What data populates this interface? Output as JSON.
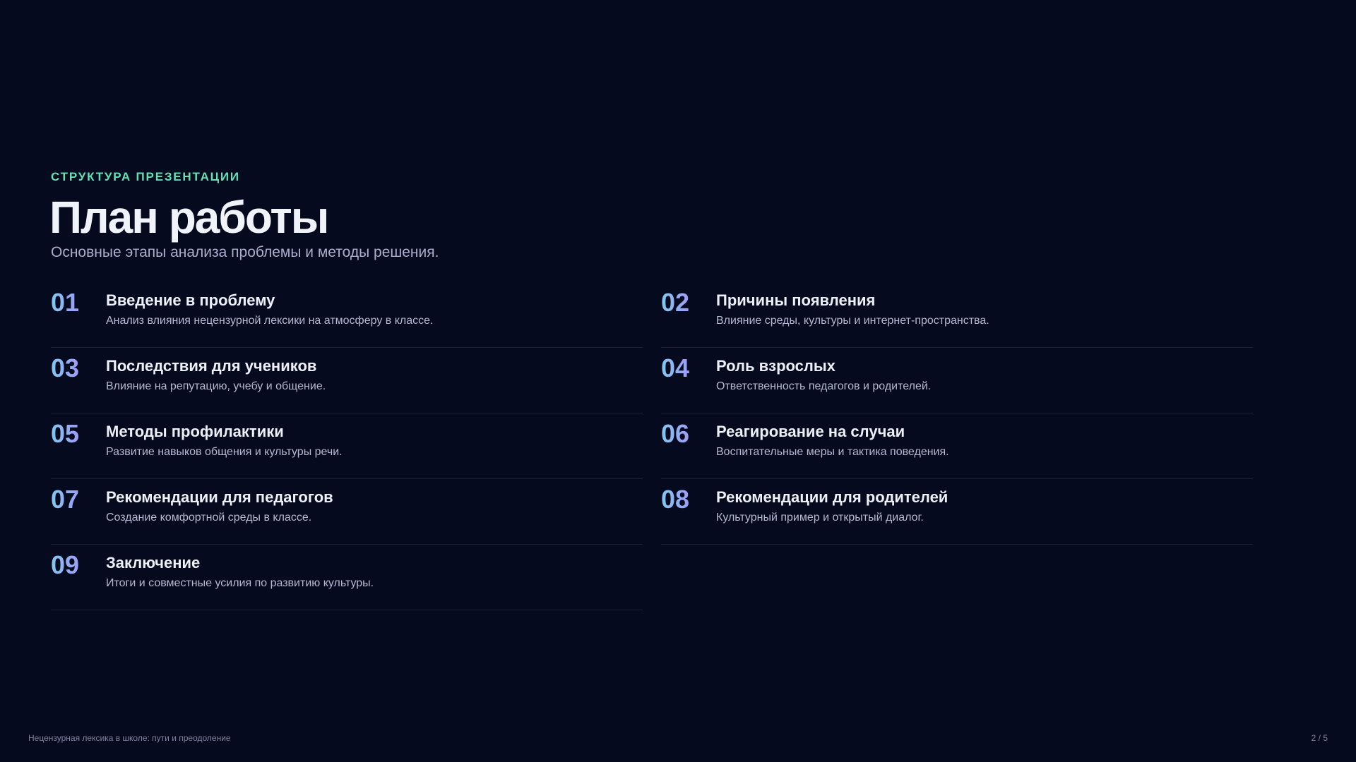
{
  "header": {
    "eyebrow": "СТРУКТУРА ПРЕЗЕНТАЦИИ",
    "title": "План работы",
    "subtitle": "Основные этапы анализа проблемы и методы решения."
  },
  "items": [
    {
      "number": "01",
      "title": "Введение в проблему",
      "description": "Анализ влияния нецензурной лексики на атмосферу в классе."
    },
    {
      "number": "02",
      "title": "Причины появления",
      "description": "Влияние среды, культуры и интернет-пространства."
    },
    {
      "number": "03",
      "title": "Последствия для учеников",
      "description": "Влияние на репутацию, учебу и общение."
    },
    {
      "number": "04",
      "title": "Роль взрослых",
      "description": "Ответственность педагогов и родителей."
    },
    {
      "number": "05",
      "title": "Методы профилактики",
      "description": "Развитие навыков общения и культуры речи."
    },
    {
      "number": "06",
      "title": "Реагирование на случаи",
      "description": "Воспитательные меры и тактика поведения."
    },
    {
      "number": "07",
      "title": "Рекомендации для педагогов",
      "description": "Создание комфортной среды в классе."
    },
    {
      "number": "08",
      "title": "Рекомендации для родителей",
      "description": "Культурный пример и открытый диалог."
    },
    {
      "number": "09",
      "title": "Заключение",
      "description": "Итоги и совместные усилия по развитию культуры."
    }
  ],
  "footer": {
    "deck_title": "Нецензурная лексика в школе: пути и преодоление",
    "page_indicator": "2 / 5"
  },
  "colors": {
    "background": "#060a1f",
    "accent": "#5ee3b4",
    "number_gradient_start": "#82c8f0",
    "number_gradient_end": "#9e9cf5"
  }
}
